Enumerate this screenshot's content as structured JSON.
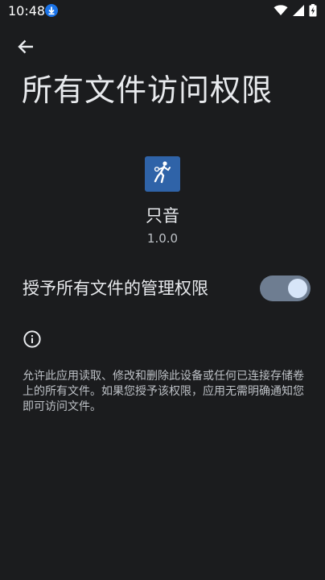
{
  "status_bar": {
    "time": "10:48",
    "icons": [
      "download-icon",
      "wifi-icon",
      "signal-icon",
      "battery-charging-icon"
    ]
  },
  "header": {
    "back_icon": "back-arrow-icon",
    "title": "所有文件访问权限"
  },
  "app": {
    "icon": "basketball-player-icon",
    "name": "只音",
    "version": "1.0.0"
  },
  "permission": {
    "label": "授予所有文件的管理权限",
    "enabled": true
  },
  "info": {
    "icon": "info-icon",
    "text": "允许此应用读取、修改和删除此设备或任何已连接存储卷上的所有文件。如果您授予该权限，应用无需明确通知您即可访问文件。"
  },
  "colors": {
    "background": "#1b1c1e",
    "app_icon_bg": "#2f63a8",
    "toggle_track": "#6e7d91",
    "toggle_thumb": "#d7e5f8",
    "status_download": "#1a73e8"
  }
}
